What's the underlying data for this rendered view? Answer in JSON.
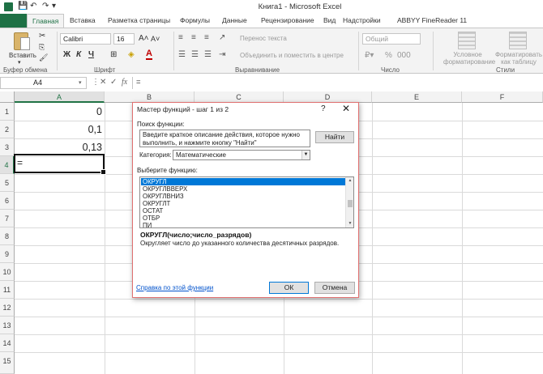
{
  "window": {
    "title": "Книга1  -  Microsoft Excel"
  },
  "tabs": [
    "Главная",
    "Вставка",
    "Разметка страницы",
    "Формулы",
    "Данные",
    "Рецензирование",
    "Вид",
    "Надстройки",
    "ABBYY FineReader 11"
  ],
  "ribbon": {
    "clipboard": {
      "paste": "Вставить",
      "label": "Буфер обмена"
    },
    "font": {
      "name": "Calibri",
      "size": "16",
      "bold": "Ж",
      "italic": "К",
      "underline": "Ч",
      "label": "Шрифт"
    },
    "alignment": {
      "wrap": "Перенос текста",
      "merge": "Объединить и поместить в центре",
      "label": "Выравнивание"
    },
    "number": {
      "format": "Общий",
      "label": "Число"
    },
    "styles": {
      "conditional": "Условное форматирование",
      "astable": "Форматировать как таблицу",
      "label": "Стили"
    }
  },
  "formula_bar": {
    "name_box": "A4",
    "content": "="
  },
  "grid": {
    "columns": [
      "A",
      "B",
      "C",
      "D",
      "E",
      "F"
    ],
    "rows": [
      "1",
      "2",
      "3",
      "4",
      "5",
      "6",
      "7",
      "8",
      "9",
      "10",
      "11",
      "12",
      "13",
      "14",
      "15"
    ],
    "values": {
      "A1": "0",
      "A2": "0,1",
      "A3": "0,13",
      "A4": "="
    }
  },
  "dialog": {
    "title": "Мастер функций - шаг 1 из 2",
    "help": "?",
    "close": "✕",
    "search_label": "Поиск функции:",
    "search_text_line1": "Введите краткое описание действия, которое нужно",
    "search_text_line2": "выполнить, и нажмите кнопку \"Найти\"",
    "find_button": "Найти",
    "category_label": "Категория:",
    "category_value": "Математические",
    "select_label": "Выберите функцию:",
    "functions": [
      "ОКРУГЛ",
      "ОКРУГЛВВЕРХ",
      "ОКРУГЛВНИЗ",
      "ОКРУГЛТ",
      "ОСТАТ",
      "ОТБР",
      "ПИ"
    ],
    "signature": "ОКРУГЛ(число;число_разрядов)",
    "description": "Округляет число до указанного количества десятичных разрядов.",
    "help_link": "Справка по этой функции",
    "ok": "ОК",
    "cancel": "Отмена"
  },
  "colors": {
    "excel_green": "#1e7145",
    "selection_blue": "#0078d7"
  }
}
